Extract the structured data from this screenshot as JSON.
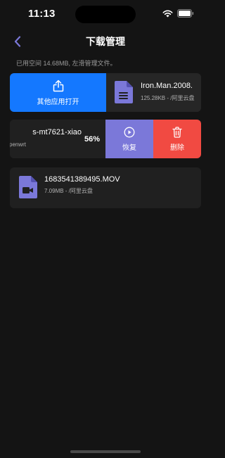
{
  "status_bar": {
    "time": "11:13"
  },
  "nav": {
    "title": "下载管理"
  },
  "storage_info": "已用空间 14.68MB, 左滑管理文件。",
  "files": [
    {
      "name": "Iron.Man.2008.",
      "meta": "125.28KB - /阿里云盘",
      "icon": "document-icon",
      "swipe_action": {
        "label": "其他应用打开",
        "icon": "share-icon",
        "color": "#1478FF"
      }
    },
    {
      "name": "s-mt7621-xiao",
      "meta": "penwrt",
      "progress": "56%",
      "actions": [
        {
          "label": "恢复",
          "icon": "play-circle-icon",
          "color": "#7B78D9"
        },
        {
          "label": "删除",
          "icon": "trash-icon",
          "color": "#F14A42"
        }
      ]
    },
    {
      "name": "1683541389495.MOV",
      "meta": "7.09MB - /阿里云盘",
      "icon": "video-file-icon"
    }
  ],
  "colors": {
    "background": "#141414",
    "card": "#202020",
    "accent": "#7B78D9"
  }
}
